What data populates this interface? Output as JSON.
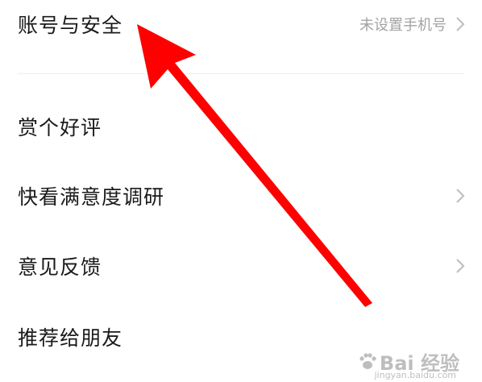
{
  "settings": {
    "account": {
      "label": "账号与安全",
      "value": "未设置手机号"
    },
    "rate": {
      "label": "赏个好评"
    },
    "survey": {
      "label": "快看满意度调研"
    },
    "feedback": {
      "label": "意见反馈"
    },
    "share": {
      "label": "推荐给朋友"
    }
  },
  "annotation": {
    "color": "#ff0000",
    "icon": "red-arrow-icon"
  },
  "watermark": {
    "text": "Bai 经验",
    "sub": "jingyan.baidu.com",
    "icon": "paw-icon"
  },
  "colors": {
    "label": "#1a1a1a",
    "value": "#a3a3a3",
    "chevron": "#bdbdbd",
    "divider": "#eeeeee"
  }
}
